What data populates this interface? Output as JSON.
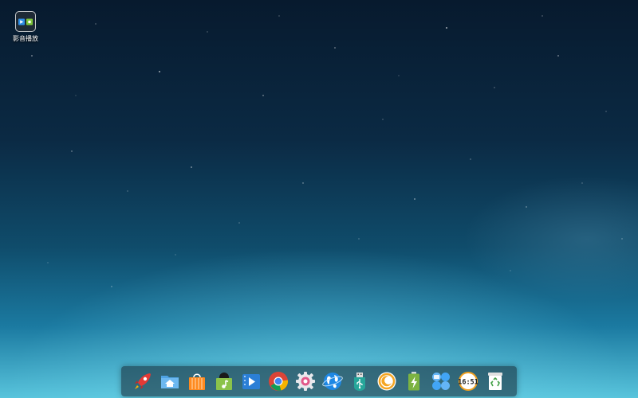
{
  "desktop": {
    "icons": [
      {
        "label": "影音播放",
        "icon": "media-player-icon"
      }
    ]
  },
  "dock": {
    "items": [
      {
        "name": "launcher",
        "icon": "rocket-icon"
      },
      {
        "name": "file-manager",
        "icon": "home-folder-icon"
      },
      {
        "name": "app-store",
        "icon": "shopping-bag-icon"
      },
      {
        "name": "music",
        "icon": "music-note-icon"
      },
      {
        "name": "video-player",
        "icon": "film-play-icon"
      },
      {
        "name": "chrome",
        "icon": "chrome-icon"
      },
      {
        "name": "settings",
        "icon": "gear-icon"
      },
      {
        "name": "browser",
        "icon": "globe-icon"
      },
      {
        "name": "usb-tool",
        "icon": "usb-icon"
      },
      {
        "name": "assistant",
        "icon": "crescent-icon"
      },
      {
        "name": "power",
        "icon": "battery-icon"
      },
      {
        "name": "control-panel",
        "icon": "apps-grid-icon"
      },
      {
        "name": "clock",
        "icon": "clock-icon",
        "text": "16:51"
      },
      {
        "name": "trash",
        "icon": "recycle-bin-icon"
      }
    ]
  }
}
